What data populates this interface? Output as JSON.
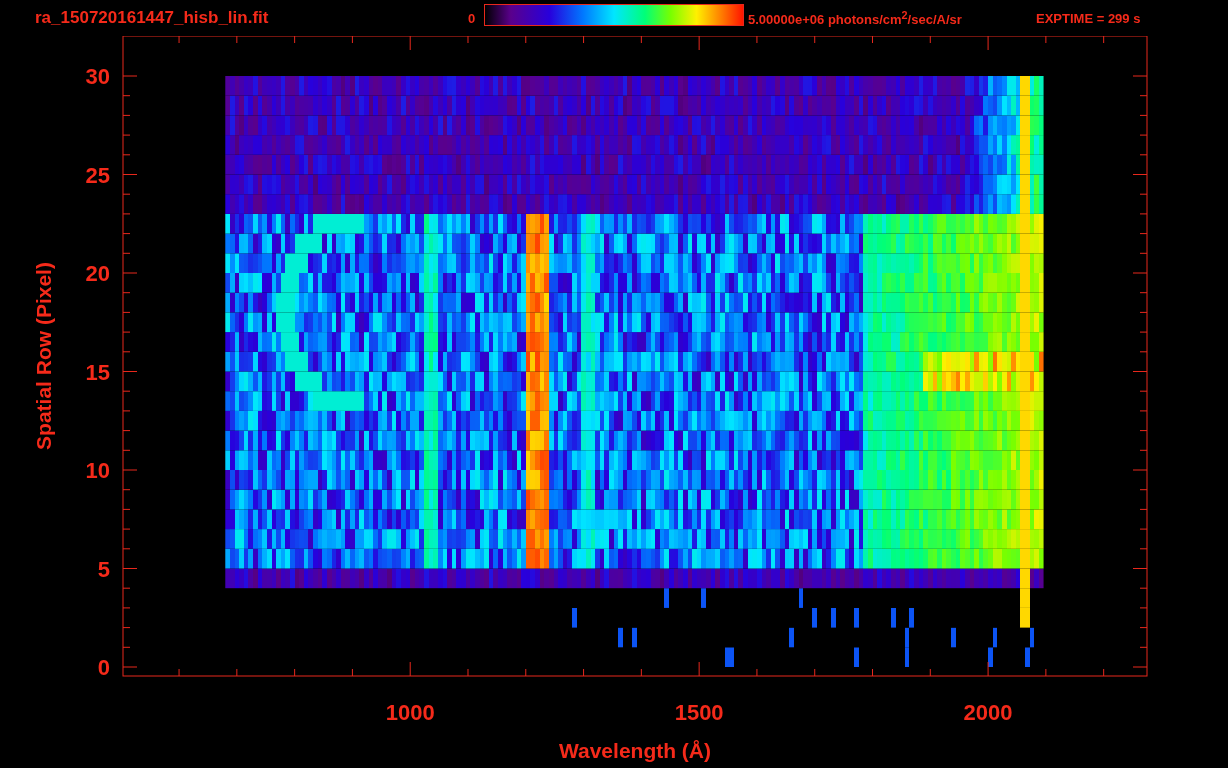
{
  "header": {
    "title": "ra_150720161447_hisb_lin.fit",
    "colorbar_min": "0",
    "colorbar_max": "5.00000e+06 photons/cm$^{2}$/sec/A/sr",
    "exposure": "EXPTIME = 299 s"
  },
  "plot": {
    "xlabel": "Wavelength (Å)",
    "ylabel": "Spatial Row (Pixel)",
    "xtick_labels": [
      "1000",
      "1500",
      "2000"
    ],
    "ytick_labels": [
      "30",
      "25",
      "20",
      "15",
      "10",
      "5",
      "0"
    ]
  }
}
